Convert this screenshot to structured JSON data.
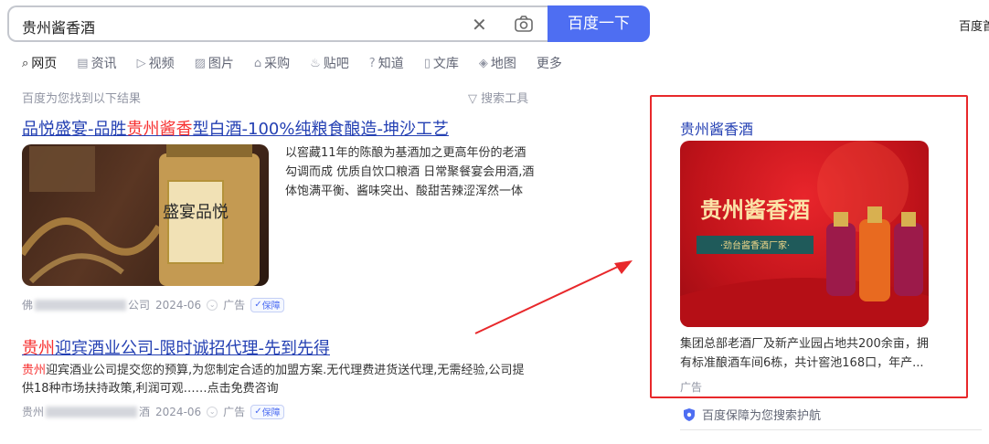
{
  "search": {
    "query": "贵州酱香酒",
    "button_label": "百度一下"
  },
  "top_right_text": "百度首",
  "tabs": [
    {
      "label": "网页",
      "icon": "search-icon"
    },
    {
      "label": "资讯",
      "icon": "news-icon"
    },
    {
      "label": "视频",
      "icon": "video-icon"
    },
    {
      "label": "图片",
      "icon": "image-icon"
    },
    {
      "label": "采购",
      "icon": "shop-icon"
    },
    {
      "label": "贴吧",
      "icon": "tieba-icon"
    },
    {
      "label": "知道",
      "icon": "question-icon"
    },
    {
      "label": "文库",
      "icon": "doc-icon"
    },
    {
      "label": "地图",
      "icon": "map-icon"
    },
    {
      "label": "更多",
      "icon": ""
    }
  ],
  "result_count": "百度为您找到以下结果",
  "search_tools": "搜索工具",
  "results": [
    {
      "title_pre": "品悦盛宴-品胜",
      "title_highlight": "贵州酱香",
      "title_post": "型白酒-100%纯粮食酿造-坤沙工艺",
      "description": "以窖藏11年的陈酿为基酒加之更高年份的老酒勾调而成 优质自饮口粮酒 日常聚餐宴会用酒,酒体饱满平衡、酱味突出、酸甜苦辣涩浑然一体",
      "image_text": "盛宴品悦",
      "source_prefix": "佛",
      "source_suffix": "公司",
      "date": "2024-06",
      "ad_label": "广告",
      "badge": "保障"
    },
    {
      "title_highlight": "贵州",
      "title_post": "迎宾酒业公司-限时诚招代理-先到先得",
      "desc_highlight": "贵州",
      "description": "迎宾酒业公司提交您的预算,为您制定合适的加盟方案.无代理费进货送代理,无需经验,公司提供18种市场扶持政策,利润可观……点击免费咨询",
      "source_prefix": "贵州",
      "source_suffix": "酒",
      "date": "2024-06",
      "ad_label": "广告",
      "badge": "保障"
    }
  ],
  "right_panel": {
    "title": "贵州酱香酒",
    "image_headline": "贵州酱香酒",
    "image_sub": "·劲台酱香酒厂家·",
    "description": "集团总部老酒厂及新产业园占地共200余亩，拥有标准酿酒车间6栋，共计窖池168口，年产...",
    "ad_label": "广告",
    "footer": "百度保障为您搜索护航"
  },
  "colors": {
    "brand_blue": "#4e6ef2",
    "link_blue": "#2440b3",
    "highlight_red": "#f73131",
    "annotation_red": "#e8282b"
  }
}
